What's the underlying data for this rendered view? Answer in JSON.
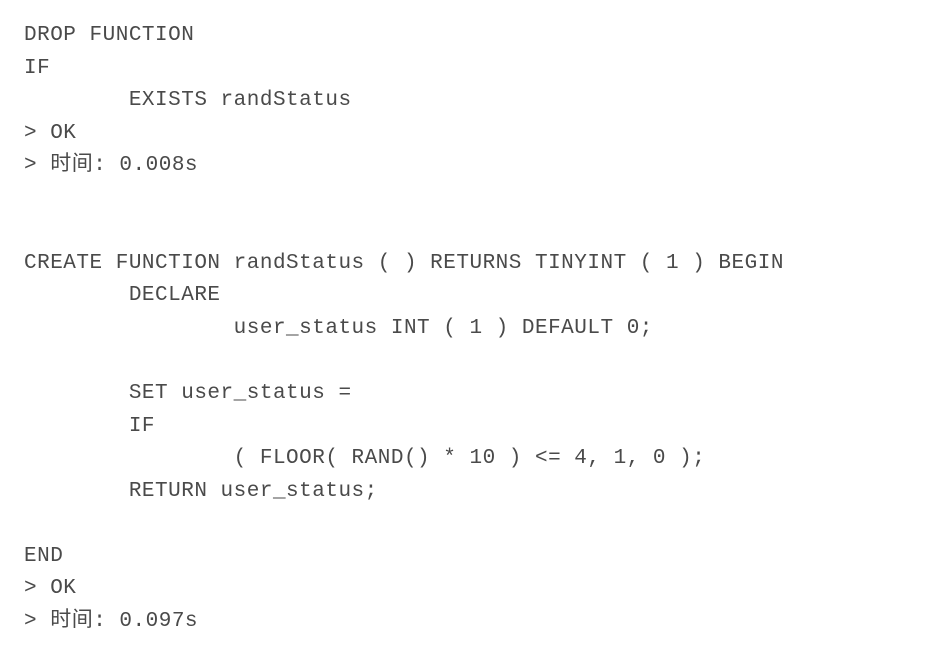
{
  "lines": {
    "l1": "DROP FUNCTION",
    "l2": "IF",
    "l3": "        EXISTS randStatus",
    "l4": "> OK",
    "l5": "> 时间: 0.008s",
    "l6": "",
    "l7": "",
    "l8": "CREATE FUNCTION randStatus ( ) RETURNS TINYINT ( 1 ) BEGIN",
    "l9": "        DECLARE",
    "l10": "                user_status INT ( 1 ) DEFAULT 0;",
    "l11": "        ",
    "l12": "        SET user_status =",
    "l13": "        IF",
    "l14": "                ( FLOOR( RAND() * 10 ) <= 4, 1, 0 );",
    "l15": "        RETURN user_status;",
    "l16": "        ",
    "l17": "END",
    "l18": "> OK",
    "l19": "> 时间: 0.097s"
  }
}
